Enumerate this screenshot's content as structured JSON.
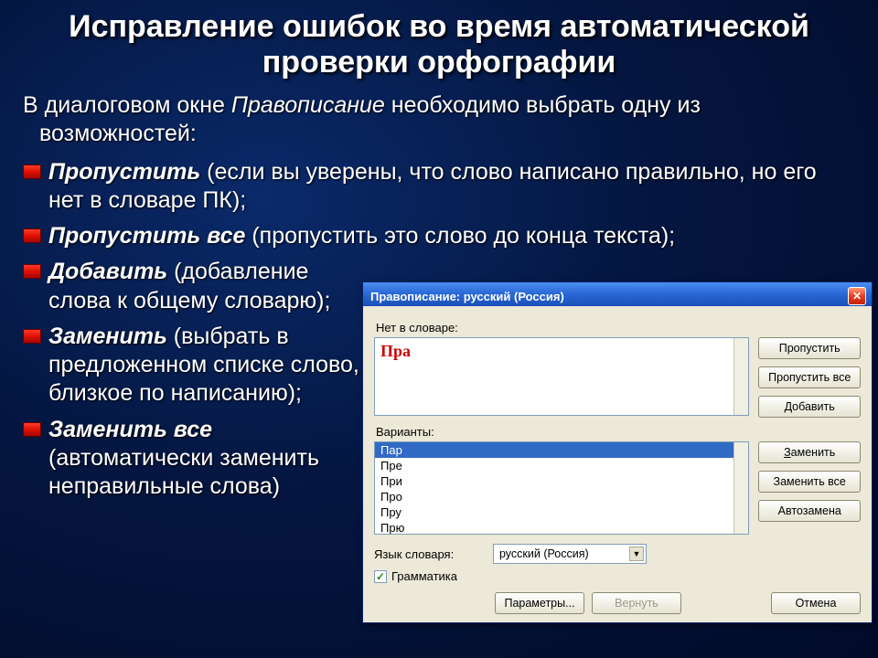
{
  "title": "Исправление ошибок во время автоматической проверки орфографии",
  "intro_a": "В диалоговом окне ",
  "intro_b": "Правописание",
  "intro_c": " необходимо выбрать одну из возможностей:",
  "items": [
    {
      "term": "Пропустить",
      "rest": " (если вы уверены, что слово написано правильно, но его нет в словаре ПК);"
    },
    {
      "term": "Пропустить все",
      "rest": "  (пропустить это слово до конца текста);"
    },
    {
      "term": "Добавить",
      "rest": "  (добавление слова к общему словарю);"
    },
    {
      "term": "Заменить",
      "rest": "  (выбрать в предложенном списке слово, близкое по написанию);"
    },
    {
      "term": "Заменить все",
      "rest": " (автоматически заменить неправильные слова)"
    }
  ],
  "dialog": {
    "title": "Правописание: русский (Россия)",
    "not_in_dict_label": "Нет в словаре:",
    "word": "Пра",
    "variants_label": "Варианты:",
    "variants": [
      "Пар",
      "Пре",
      "При",
      "Про",
      "Пру",
      "Прю"
    ],
    "buttons": {
      "skip": "Пропустить",
      "skip_all": "Пропустить все",
      "add": "Добавить",
      "replace": "Заменить",
      "replace_all": "Заменить все",
      "autocorrect": "Автозамена",
      "options": "Параметры...",
      "revert": "Вернуть",
      "cancel": "Отмена"
    },
    "lang_label": "Язык словаря:",
    "lang_value": "русский (Россия)",
    "grammar_label": "Грамматика"
  }
}
